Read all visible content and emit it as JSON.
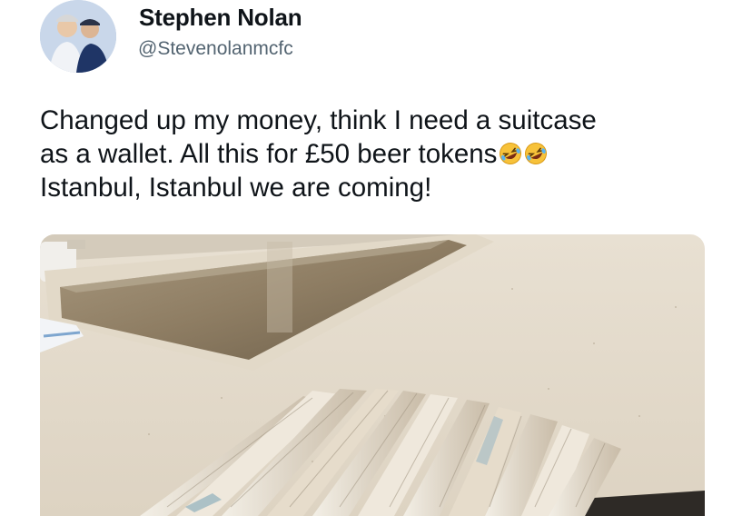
{
  "tweet": {
    "author": {
      "display_name": "Stephen Nolan",
      "handle": "@Stevenolanmcfc",
      "avatar_icon": "profile-photo-icon"
    },
    "text_lines": [
      "Changed up my money, think I need a suitcase",
      "as a wallet. All this for £50 beer tokens",
      "Istanbul, Istanbul we are coming!"
    ],
    "emojis": [
      "rolling-on-floor-laughing-icon",
      "rolling-on-floor-laughing-icon"
    ],
    "media": {
      "icon": "photo-banknotes-on-counter-icon"
    }
  },
  "colors": {
    "text_primary": "#0f1419",
    "text_secondary": "#536471",
    "background": "#ffffff",
    "emoji_yellow": "#f7c23a"
  }
}
